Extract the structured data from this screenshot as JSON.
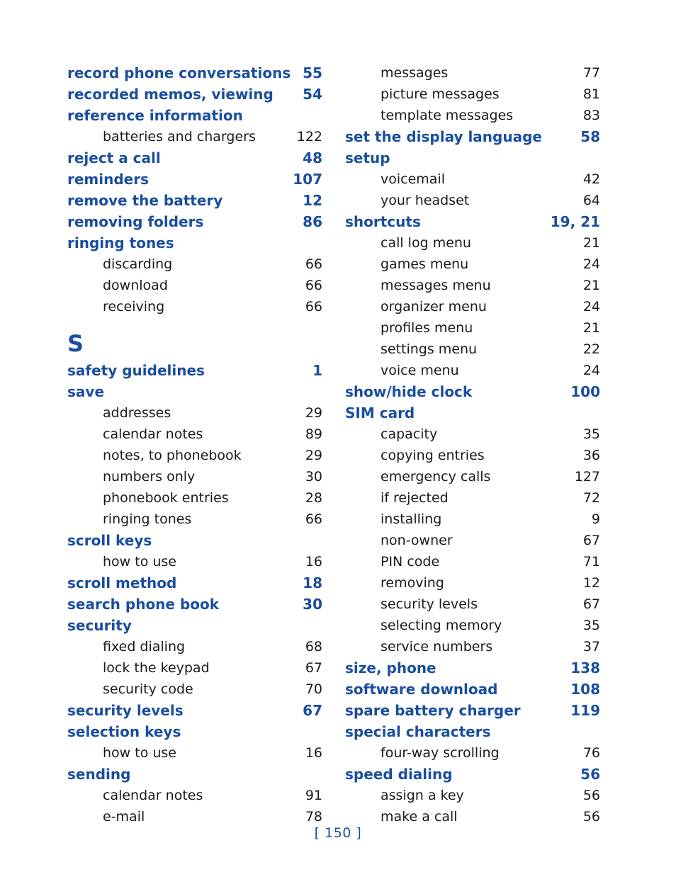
{
  "page": {
    "footer_label": "[ 150 ]",
    "accent_color": "#1a4e9e",
    "body_color": "#1a1a1a"
  },
  "left_column": {
    "blocks": [
      {
        "kind": "entry",
        "level": "main",
        "label": "record phone conversations",
        "page": "55"
      },
      {
        "kind": "entry",
        "level": "main",
        "label": "recorded memos, viewing",
        "page": "54"
      },
      {
        "kind": "entry",
        "level": "main",
        "label": "reference information",
        "page": ""
      },
      {
        "kind": "entry",
        "level": "sub",
        "label": "batteries and chargers",
        "page": "122"
      },
      {
        "kind": "entry",
        "level": "main",
        "label": "reject a call",
        "page": "48"
      },
      {
        "kind": "entry",
        "level": "main",
        "label": "reminders",
        "page": "107"
      },
      {
        "kind": "entry",
        "level": "main",
        "label": "remove the battery",
        "page": "12"
      },
      {
        "kind": "entry",
        "level": "main",
        "label": "removing folders",
        "page": "86"
      },
      {
        "kind": "entry",
        "level": "main",
        "label": "ringing tones",
        "page": ""
      },
      {
        "kind": "entry",
        "level": "sub",
        "label": "discarding",
        "page": "66"
      },
      {
        "kind": "entry",
        "level": "sub",
        "label": "download",
        "page": "66"
      },
      {
        "kind": "entry",
        "level": "sub",
        "label": "receiving",
        "page": "66"
      },
      {
        "kind": "letter",
        "label": "S"
      },
      {
        "kind": "entry",
        "level": "main",
        "label": "safety guidelines",
        "page": "1"
      },
      {
        "kind": "entry",
        "level": "main",
        "label": "save",
        "page": ""
      },
      {
        "kind": "entry",
        "level": "sub",
        "label": "addresses",
        "page": "29"
      },
      {
        "kind": "entry",
        "level": "sub",
        "label": "calendar notes",
        "page": "89"
      },
      {
        "kind": "entry",
        "level": "sub",
        "label": "notes, to phonebook",
        "page": "29"
      },
      {
        "kind": "entry",
        "level": "sub",
        "label": "numbers only",
        "page": "30"
      },
      {
        "kind": "entry",
        "level": "sub",
        "label": "phonebook entries",
        "page": "28"
      },
      {
        "kind": "entry",
        "level": "sub",
        "label": "ringing tones",
        "page": "66"
      },
      {
        "kind": "entry",
        "level": "main",
        "label": "scroll keys",
        "page": ""
      },
      {
        "kind": "entry",
        "level": "sub",
        "label": "how to use",
        "page": "16"
      },
      {
        "kind": "entry",
        "level": "main",
        "label": "scroll method",
        "page": "18"
      },
      {
        "kind": "entry",
        "level": "main",
        "label": "search phone book",
        "page": "30"
      },
      {
        "kind": "entry",
        "level": "main",
        "label": "security",
        "page": ""
      },
      {
        "kind": "entry",
        "level": "sub",
        "label": "fixed dialing",
        "page": "68"
      },
      {
        "kind": "entry",
        "level": "sub",
        "label": "lock the keypad",
        "page": "67"
      },
      {
        "kind": "entry",
        "level": "sub",
        "label": "security code",
        "page": "70"
      },
      {
        "kind": "entry",
        "level": "main",
        "label": "security levels",
        "page": "67"
      },
      {
        "kind": "entry",
        "level": "main",
        "label": "selection keys",
        "page": ""
      },
      {
        "kind": "entry",
        "level": "sub",
        "label": "how to use",
        "page": "16"
      },
      {
        "kind": "entry",
        "level": "main",
        "label": "sending",
        "page": ""
      },
      {
        "kind": "entry",
        "level": "sub",
        "label": "calendar notes",
        "page": "91"
      },
      {
        "kind": "entry",
        "level": "sub",
        "label": "e-mail",
        "page": "78"
      }
    ]
  },
  "right_column": {
    "blocks": [
      {
        "kind": "entry",
        "level": "sub",
        "label": "messages",
        "page": "77"
      },
      {
        "kind": "entry",
        "level": "sub",
        "label": "picture messages",
        "page": "81"
      },
      {
        "kind": "entry",
        "level": "sub",
        "label": "template messages",
        "page": "83"
      },
      {
        "kind": "entry",
        "level": "main",
        "label": "set the display language",
        "page": "58"
      },
      {
        "kind": "entry",
        "level": "main",
        "label": "setup",
        "page": ""
      },
      {
        "kind": "entry",
        "level": "sub",
        "label": "voicemail",
        "page": "42"
      },
      {
        "kind": "entry",
        "level": "sub",
        "label": "your headset",
        "page": "64"
      },
      {
        "kind": "entry",
        "level": "main",
        "label": "shortcuts",
        "page": "19, 21"
      },
      {
        "kind": "entry",
        "level": "sub",
        "label": "call log menu",
        "page": "21"
      },
      {
        "kind": "entry",
        "level": "sub",
        "label": "games menu",
        "page": "24"
      },
      {
        "kind": "entry",
        "level": "sub",
        "label": "messages menu",
        "page": "21"
      },
      {
        "kind": "entry",
        "level": "sub",
        "label": "organizer menu",
        "page": "24"
      },
      {
        "kind": "entry",
        "level": "sub",
        "label": "profiles menu",
        "page": "21"
      },
      {
        "kind": "entry",
        "level": "sub",
        "label": "settings menu",
        "page": "22"
      },
      {
        "kind": "entry",
        "level": "sub",
        "label": "voice menu",
        "page": "24"
      },
      {
        "kind": "entry",
        "level": "main",
        "label": "show/hide clock",
        "page": "100"
      },
      {
        "kind": "entry",
        "level": "main",
        "label": "SIM card",
        "page": ""
      },
      {
        "kind": "entry",
        "level": "sub",
        "label": "capacity",
        "page": "35"
      },
      {
        "kind": "entry",
        "level": "sub",
        "label": "copying entries",
        "page": "36"
      },
      {
        "kind": "entry",
        "level": "sub",
        "label": "emergency calls",
        "page": "127"
      },
      {
        "kind": "entry",
        "level": "sub",
        "label": "if rejected",
        "page": "72"
      },
      {
        "kind": "entry",
        "level": "sub",
        "label": "installing",
        "page": "9"
      },
      {
        "kind": "entry",
        "level": "sub",
        "label": "non-owner",
        "page": "67"
      },
      {
        "kind": "entry",
        "level": "sub",
        "label": "PIN code",
        "page": "71"
      },
      {
        "kind": "entry",
        "level": "sub",
        "label": "removing",
        "page": "12"
      },
      {
        "kind": "entry",
        "level": "sub",
        "label": "security levels",
        "page": "67"
      },
      {
        "kind": "entry",
        "level": "sub",
        "label": "selecting memory",
        "page": "35"
      },
      {
        "kind": "entry",
        "level": "sub",
        "label": "service numbers",
        "page": "37"
      },
      {
        "kind": "entry",
        "level": "main",
        "label": "size, phone",
        "page": "138"
      },
      {
        "kind": "entry",
        "level": "main",
        "label": "software download",
        "page": "108"
      },
      {
        "kind": "entry",
        "level": "main",
        "label": "spare battery charger",
        "page": "119"
      },
      {
        "kind": "entry",
        "level": "main",
        "label": "special characters",
        "page": ""
      },
      {
        "kind": "entry",
        "level": "sub",
        "label": "four-way scrolling",
        "page": "76"
      },
      {
        "kind": "entry",
        "level": "main",
        "label": "speed dialing",
        "page": "56"
      },
      {
        "kind": "entry",
        "level": "sub",
        "label": "assign a key",
        "page": "56"
      },
      {
        "kind": "entry",
        "level": "sub",
        "label": "make a call",
        "page": "56"
      }
    ]
  }
}
